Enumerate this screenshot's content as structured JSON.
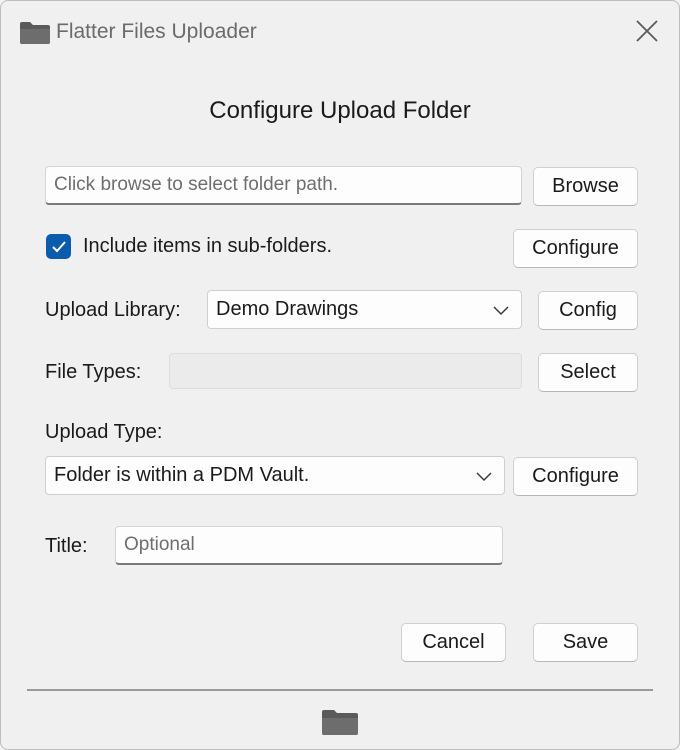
{
  "window": {
    "title": "Flatter Files Uploader",
    "app_icon": "folder-icon",
    "close_icon": "close-icon"
  },
  "dialog": {
    "heading": "Configure Upload Folder",
    "folder_path": {
      "placeholder": "Click browse to select folder path.",
      "value": ""
    },
    "browse_label": "Browse",
    "subfolders": {
      "label": "Include items in sub-folders.",
      "checked": true,
      "configure_label": "Configure"
    },
    "library": {
      "label": "Upload Library:",
      "selected": "Demo Drawings",
      "config_label": "Config"
    },
    "file_types": {
      "label": "File Types:",
      "value": "",
      "select_label": "Select"
    },
    "upload_type": {
      "label": "Upload Type:",
      "selected": "Folder is within a PDM Vault.",
      "configure_label": "Configure"
    },
    "title_field": {
      "label": "Title:",
      "placeholder": "Optional",
      "value": ""
    },
    "cancel_label": "Cancel",
    "save_label": "Save"
  },
  "footer": {
    "icon": "folder-icon"
  },
  "colors": {
    "accent": "#0b5cad",
    "window_bg": "#f0f0f0"
  }
}
